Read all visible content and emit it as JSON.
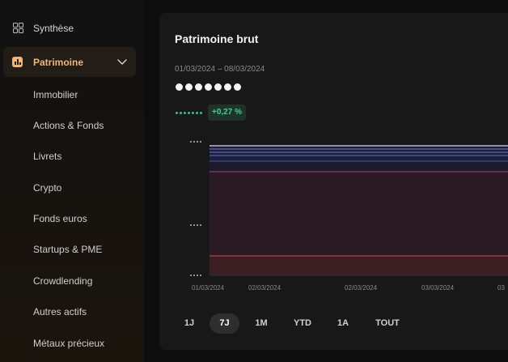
{
  "sidebar": {
    "synthese": "Synthèse",
    "patrimoine": "Patrimoine",
    "sub_items": [
      "Immobilier",
      "Actions & Fonds",
      "Livrets",
      "Crypto",
      "Fonds euros",
      "Startups & PME",
      "Crowdlending",
      "Autres actifs",
      "Métaux précieux"
    ]
  },
  "panel": {
    "title": "Patrimoine brut",
    "date_range": "01/03/2024 – 08/03/2024",
    "change_badge": "+0,27 %"
  },
  "chart_data": {
    "type": "area",
    "x_tick_labels": [
      "01/03/2024",
      "02/03/2024",
      "02/03/2024",
      "03/03/2024",
      "03"
    ],
    "y_tick_labels_masked": true,
    "values_masked": true,
    "grid": false
  },
  "time_ranges": [
    "1J",
    "7J",
    "1M",
    "YTD",
    "1A",
    "TOUT"
  ],
  "active_range": "7J",
  "colors": {
    "accent": "#f0b674",
    "positive": "#3fd39a",
    "panel_bg": "#181818"
  }
}
